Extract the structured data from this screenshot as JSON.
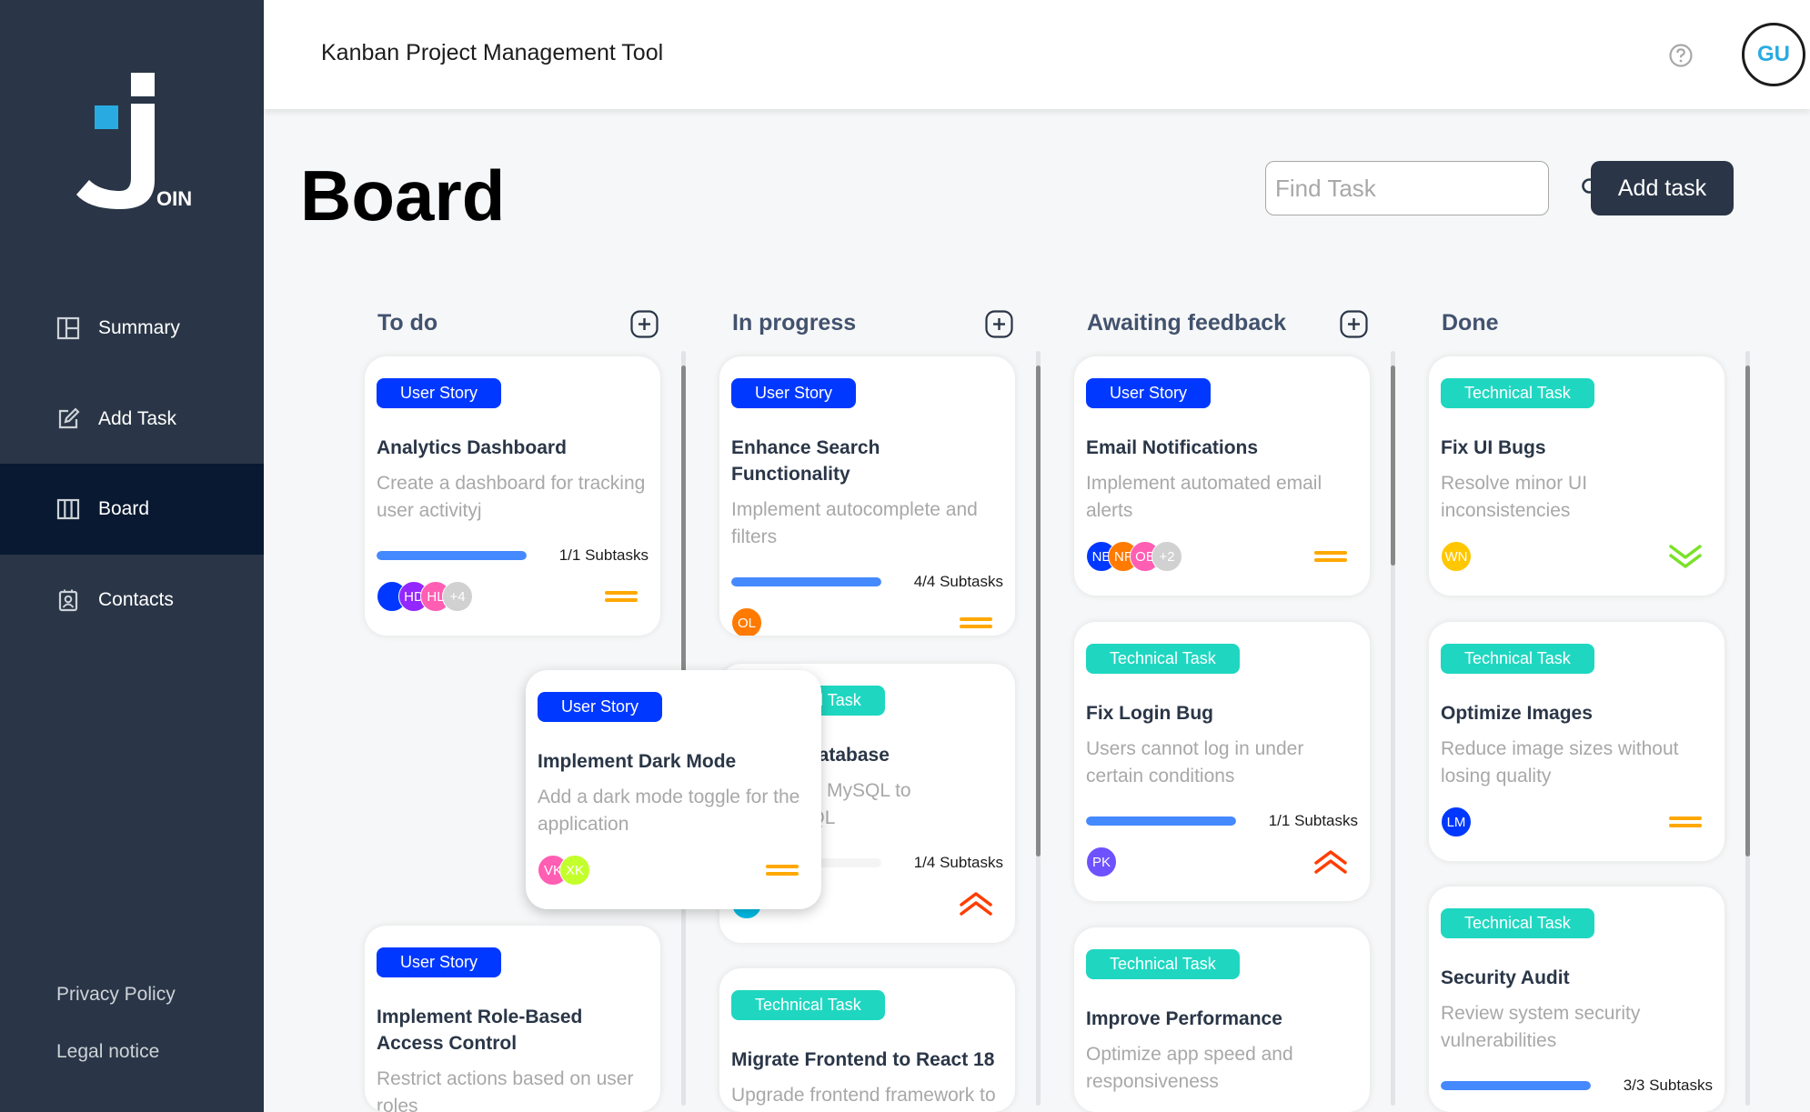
{
  "colors": {
    "sidebar": "#2a3647",
    "active_nav": "#091931",
    "accent": "#29abe2",
    "user_story": "#0038ff",
    "technical_task": "#1fd7c1",
    "progress": "#4589ff",
    "prio_low": "#7ae229",
    "prio_medium": "#ffa800",
    "prio_urgent": "#ff3d00"
  },
  "logo": {
    "text": "OIN"
  },
  "nav": {
    "summary": {
      "label": "Summary",
      "icon": "summary-icon"
    },
    "add_task": {
      "label": "Add Task",
      "icon": "edit-icon"
    },
    "board": {
      "label": "Board",
      "icon": "board-icon"
    },
    "contacts": {
      "label": "Contacts",
      "icon": "contacts-icon"
    }
  },
  "footer": {
    "privacy": "Privacy Policy",
    "legal": "Legal notice"
  },
  "header": {
    "title": "Kanban Project Management Tool",
    "help_icon": "help-icon",
    "user_initials": "GU"
  },
  "board": {
    "title": "Board",
    "search_placeholder": "Find Task",
    "search_icon": "search-icon",
    "add_task": "Add task"
  },
  "columns": {
    "todo": {
      "title": "To do"
    },
    "progress": {
      "title": "In progress"
    },
    "feedback": {
      "title": "Awaiting feedback"
    },
    "done": {
      "title": "Done"
    }
  },
  "cards": {
    "c1": {
      "category": "User Story",
      "title": "Analytics Dashboard",
      "description": "Create a dashboard for tracking user activityj",
      "subtasks": "1/1 Subtasks",
      "progress": 1,
      "priority": "medium",
      "avatars": [
        {
          "initials": "",
          "color": "#0038ff"
        },
        {
          "initials": "HD",
          "color": "#9327ff"
        },
        {
          "initials": "HL",
          "color": "#ff5eb3"
        },
        {
          "initials": "+4",
          "color": "#d1d1d1"
        }
      ]
    },
    "c2": {
      "category": "User Story",
      "title": "Implement Role-Based Access Control",
      "description": "Restrict actions based on user roles"
    },
    "drag": {
      "category": "User Story",
      "title": "Implement Dark Mode",
      "description": "Add a dark mode toggle for the application",
      "priority": "medium",
      "avatars": [
        {
          "initials": "VK",
          "color": "#ff5eb3"
        },
        {
          "initials": "XK",
          "color": "#c3ff2b"
        }
      ]
    },
    "p1": {
      "category": "User Story",
      "title": "Enhance Search Functionality",
      "description": "Implement autocomplete and filters",
      "subtasks": "4/4 Subtasks",
      "progress": 1,
      "priority": "medium",
      "avatars": [
        {
          "initials": "OL",
          "color": "#ff7a00"
        }
      ]
    },
    "p2": {
      "category": "Technical Task",
      "title": "Migrate Database",
      "description": "Move from MySQL to PostgreSQL",
      "subtasks": "1/4 Subtasks",
      "progress": 0.25,
      "priority": "urgent",
      "avatars": [
        {
          "initials": "RW",
          "color": "#00bee8"
        }
      ]
    },
    "p3": {
      "category": "Technical Task",
      "title": "Migrate Frontend to React 18",
      "description": "Upgrade frontend framework to"
    },
    "f1": {
      "category": "User Story",
      "title": "Email Notifications",
      "description": "Implement automated email alerts",
      "priority": "medium",
      "avatars": [
        {
          "initials": "NE",
          "color": "#0038ff"
        },
        {
          "initials": "NF",
          "color": "#ff7a00"
        },
        {
          "initials": "OE",
          "color": "#ff5eb3"
        },
        {
          "initials": "+2",
          "color": "#d1d1d1"
        }
      ]
    },
    "f2": {
      "category": "Technical Task",
      "title": "Fix Login Bug",
      "description": "Users cannot log in under certain conditions",
      "subtasks": "1/1 Subtasks",
      "progress": 1,
      "priority": "urgent",
      "avatars": [
        {
          "initials": "PK",
          "color": "#6e52ff"
        }
      ]
    },
    "f3": {
      "category": "Technical Task",
      "title": "Improve Performance",
      "description": "Optimize app speed and responsiveness"
    },
    "d1": {
      "category": "Technical Task",
      "title": "Fix UI Bugs",
      "description": "Resolve minor UI inconsistencies",
      "priority": "low",
      "avatars": [
        {
          "initials": "WN",
          "color": "#ffc701"
        }
      ]
    },
    "d2": {
      "category": "Technical Task",
      "title": "Optimize Images",
      "description": "Reduce image sizes without losing quality",
      "priority": "medium",
      "avatars": [
        {
          "initials": "LM",
          "color": "#0038ff"
        }
      ]
    },
    "d3": {
      "category": "Technical Task",
      "title": "Security Audit",
      "description": "Review system security vulnerabilities",
      "subtasks": "3/3 Subtasks",
      "progress": 1
    }
  }
}
